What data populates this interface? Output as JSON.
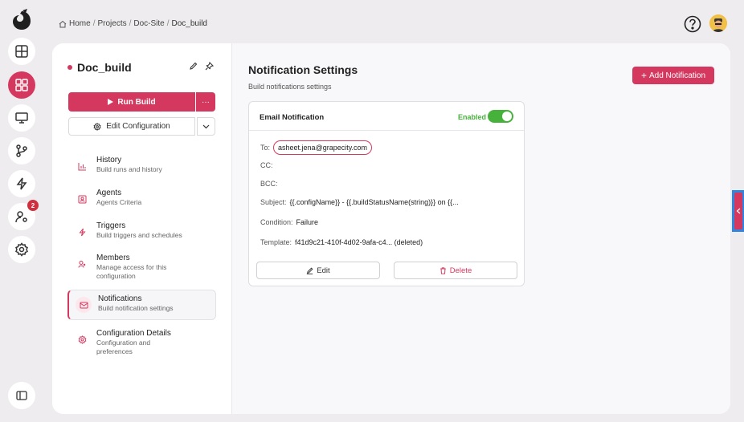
{
  "breadcrumb": {
    "items": [
      "Home",
      "Projects",
      "Doc-Site"
    ],
    "current": "Doc_build",
    "separator": "/"
  },
  "rail": {
    "notifications_badge": "2"
  },
  "project": {
    "name": "Doc_build",
    "run_label": "Run Build",
    "run_more": "···",
    "config_label": "Edit Configuration"
  },
  "nav": [
    {
      "label": "History",
      "sub": "Build runs and history"
    },
    {
      "label": "Agents",
      "sub": "Agents Criteria"
    },
    {
      "label": "Triggers",
      "sub": "Build triggers and schedules"
    },
    {
      "label": "Members",
      "sub": "Manage access for this configuration"
    },
    {
      "label": "Notifications",
      "sub": "Build notification settings"
    },
    {
      "label": "Configuration Details",
      "sub": "Configuration and preferences"
    }
  ],
  "page": {
    "title": "Notification Settings",
    "subtitle": "Build notifications settings",
    "add_label": "Add Notification"
  },
  "notification": {
    "title": "Email Notification",
    "status": "Enabled",
    "to_label": "To:",
    "to_value": "asheet.jena@grapecity.com",
    "cc_label": "CC:",
    "bcc_label": "BCC:",
    "subject_label": "Subject:",
    "subject_value": "{{.configName}} - {{.buildStatusName(string)}} on {{...",
    "condition_label": "Condition:",
    "condition_value": "Failure",
    "template_label": "Template:",
    "template_value": "f41d9c21-410f-4d02-9afa-c4... (deleted)",
    "edit_label": "Edit",
    "delete_label": "Delete"
  },
  "colors": {
    "accent": "#d5385f",
    "enabled": "#47b23b"
  }
}
